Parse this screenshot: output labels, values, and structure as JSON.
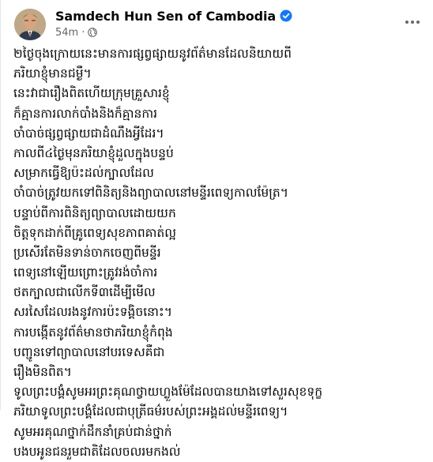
{
  "post": {
    "author": "Samdech Hun Sen of Cambodia",
    "verified": true,
    "time": "54m",
    "separator": "·",
    "audience_icon": "globe-icon",
    "more_icon": "more-options-icon",
    "lines": [
      "២ថ្ងៃចុងក្រោយនេះមានការផ្សព្វផ្សាយនូវព័ត៌មានដែលនិយាយពី",
      "ភរិយាខ្ញុំមានជម្ងឺ។",
      "នេះវាជារឿងពិតហើយក្រុមគ្រួសារខ្ញុំ",
      "ក៏គ្មានការលាក់បាំងនិងក៏គ្មានការ",
      "ចាំបាច់ផ្សព្វផ្សាយជាដំណឹងអ្វីដែរ។",
      "កាលពី៤ថ្ងៃមុនភរិយាខ្ញុំដួលក្នុងបន្ទប់",
      "សម្រាកធ្វើឱ្យប៉ះដល់ក្បាលដែល",
      "ចាំបាច់ត្រូវយកទៅពិនិត្យនិងព្យាបាលនៅមន្ទីរពេទ្យកាលម៉ែត្រ។",
      "បន្ទាប់ពីការពិនិត្យព្យាបាលដោយយក",
      "ចិត្តទុកដាក់ពីគ្រូពេទ្យសុខភាពគាត់ល្អ",
      "ប្រសើរតែមិនទាន់ចាកចេញពីមន្ទីរ",
      "ពេទ្យនៅឡើយព្រោះត្រូវរង់ចាំការ",
      "ថតក្បាលជាលើកទី៣ដើម្បីមើល",
      "សរសៃដែលរងនូវការប៉ះទង្គិចនោះ។",
      "ការបង្កើតនូវព័ត៌មានថាភរិយាខ្ញុំកំពុង",
      "បញ្ជូនទៅព្យាបាលនៅបរទេសគឺជា",
      "រឿងមិនពិត។",
      "ទូលព្រះបង្គំសូមអរព្រះគុណថ្វាយហ្លួងម៉ែដែលបានយាងទៅសួរសុខទុក្ខ",
      "ភរិយាទូលព្រះបង្គំដែលជាបុត្រីធម៌របស់ព្រះអង្គដល់មន្ទីរពេទ្យ។",
      "សូមអរគុណថ្នាក់ដឹកនាំគ្រប់ជាន់ថ្នាក់",
      "បងបអូនជនរួមជាតិដែលចលរមកងល់"
    ]
  },
  "colors": {
    "name": "#050505",
    "meta": "#65676b",
    "verified": "#1877f2",
    "body_text": "#050505"
  }
}
